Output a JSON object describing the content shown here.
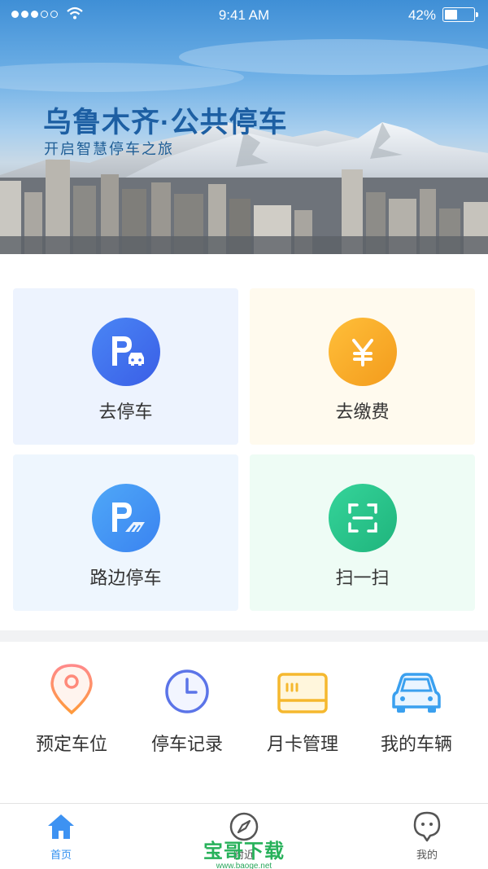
{
  "status_bar": {
    "time": "9:41 AM",
    "battery": "42%"
  },
  "hero": {
    "title": "乌鲁木齐·公共停车",
    "subtitle": "开启智慧停车之旅"
  },
  "services": [
    {
      "label": "去停车",
      "icon": "parking-car-icon",
      "color": "#3f6ff0",
      "bg": "#edf3fe"
    },
    {
      "label": "去缴费",
      "icon": "yuan-icon",
      "color": "#f6a321",
      "bg": "#fffaee"
    },
    {
      "label": "路边停车",
      "icon": "roadside-parking-icon",
      "color": "#3a8ff5",
      "bg": "#eef6fe"
    },
    {
      "label": "扫一扫",
      "icon": "scan-icon",
      "color": "#2bc48c",
      "bg": "#eefcf5"
    }
  ],
  "quick_actions": [
    {
      "label": "预定车位",
      "icon": "location-pin-icon"
    },
    {
      "label": "停车记录",
      "icon": "clock-icon"
    },
    {
      "label": "月卡管理",
      "icon": "card-icon"
    },
    {
      "label": "我的车辆",
      "icon": "car-icon"
    }
  ],
  "tabbar": [
    {
      "label": "首页",
      "icon": "home-icon",
      "active": true
    },
    {
      "label": "附近",
      "icon": "compass-icon",
      "active": false
    },
    {
      "label": "我的",
      "icon": "user-icon",
      "active": false
    }
  ],
  "watermark": {
    "main": "宝哥下载",
    "sub": "www.baoge.net"
  }
}
